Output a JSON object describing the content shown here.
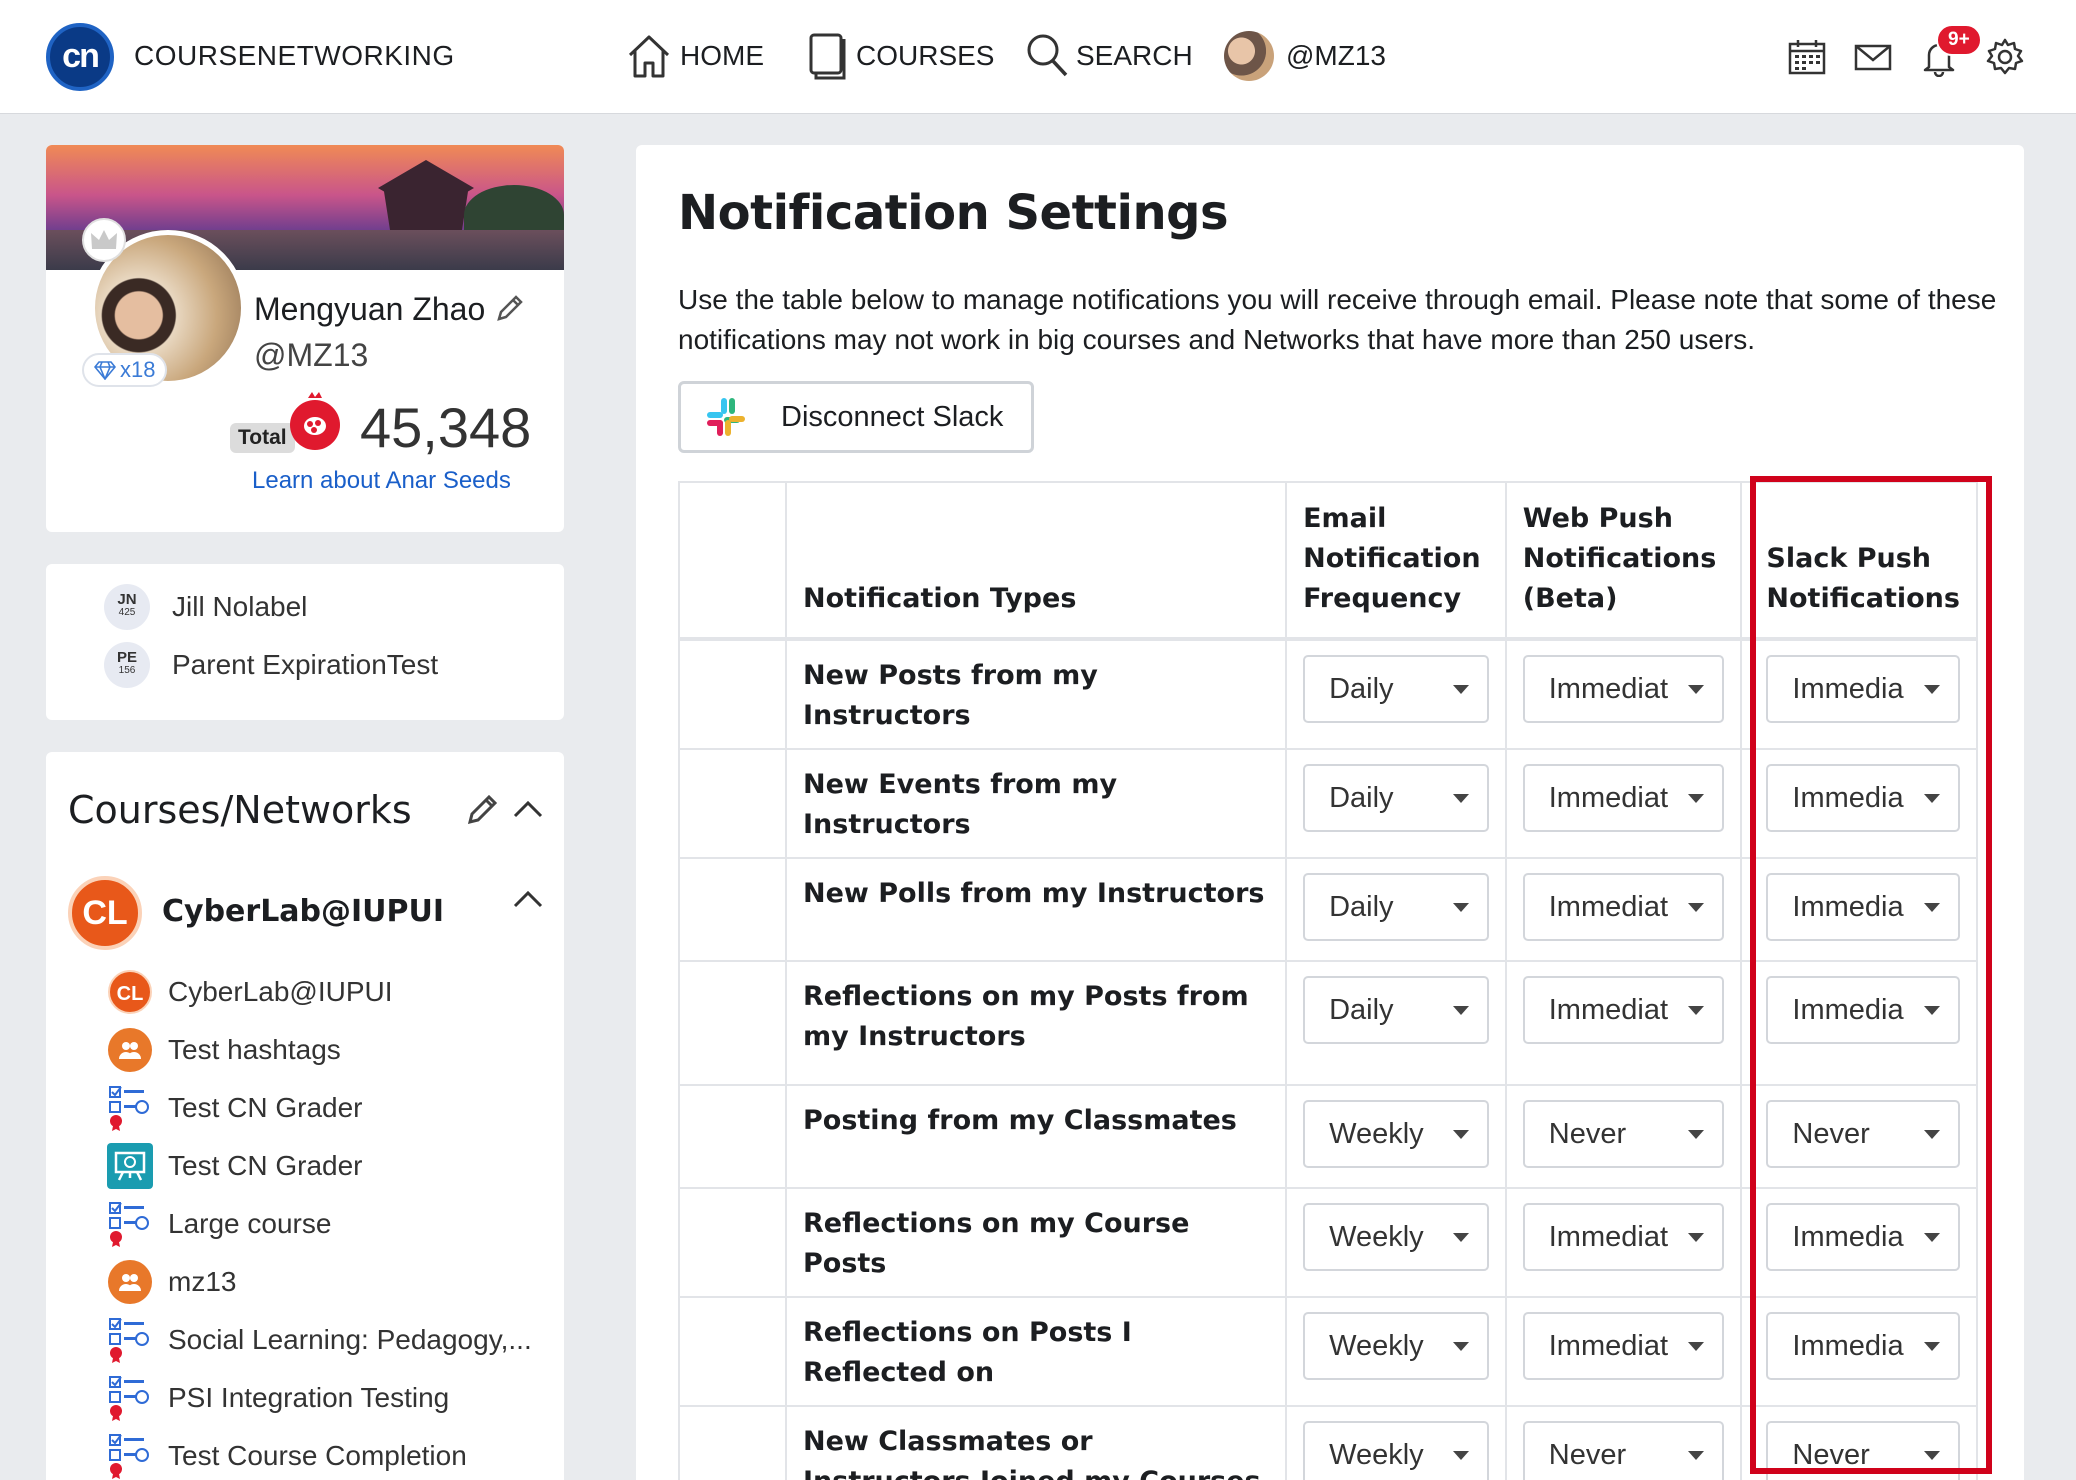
{
  "topbar": {
    "logo_text": "cn",
    "brand": "COURSENETWORKING",
    "nav": [
      {
        "label": "HOME",
        "icon": "home-icon"
      },
      {
        "label": "COURSES",
        "icon": "book-icon"
      },
      {
        "label": "SEARCH",
        "icon": "search-icon"
      }
    ],
    "user_handle": "@MZ13",
    "notification_badge": "9+",
    "right_icons": [
      "calendar-icon",
      "mail-icon",
      "bell-icon",
      "gear-icon"
    ]
  },
  "profile": {
    "name": "Mengyuan Zhao",
    "handle": "@MZ13",
    "diamonds": "x18",
    "total_label": "Total",
    "score": "45,348",
    "learn_link": "Learn about Anar Seeds"
  },
  "people": [
    {
      "initials": "JN",
      "number": "425",
      "name": "Jill Nolabel"
    },
    {
      "initials": "PE",
      "number": "156",
      "name": "Parent ExpirationTest"
    }
  ],
  "courses": {
    "title": "Courses/Networks",
    "group_logo": "CL",
    "group_name": "CyberLab@IUPUI",
    "items": [
      {
        "name": "CyberLab@IUPUI",
        "icon": "cyberlab-icon"
      },
      {
        "name": "Test hashtags",
        "icon": "group-icon"
      },
      {
        "name": "Test CN Grader",
        "icon": "course-checklist-icon"
      },
      {
        "name": "Test CN Grader",
        "icon": "course-board-icon"
      },
      {
        "name": "Large course",
        "icon": "course-checklist-icon"
      },
      {
        "name": "mz13",
        "icon": "group-icon"
      },
      {
        "name": "Social Learning: Pedagogy,...",
        "icon": "course-checklist-icon"
      },
      {
        "name": "PSI Integration Testing",
        "icon": "course-checklist-icon"
      },
      {
        "name": "Test Course Completion",
        "icon": "course-checklist-icon"
      }
    ]
  },
  "main": {
    "title": "Notification Settings",
    "description": "Use the table below to manage notifications you will receive through email. Please note that some of these notifications may not work in big courses and Networks that have more than 250 users.",
    "slack_button": "Disconnect Slack",
    "columns": {
      "type": "Notification Types",
      "email": "Email Notification Frequency",
      "web": "Web Push Notifications (Beta)",
      "slack": "Slack Push Notifications"
    },
    "rows": [
      {
        "type": "New Posts from my Instructors",
        "email": "Daily",
        "web": "Immediat",
        "slack": "Immedia"
      },
      {
        "type": "New Events from my Instructors",
        "email": "Daily",
        "web": "Immediat",
        "slack": "Immedia"
      },
      {
        "type": "New Polls from my Instructors",
        "email": "Daily",
        "web": "Immediat",
        "slack": "Immedia"
      },
      {
        "type": "Reflections on my Posts from my Instructors",
        "email": "Daily",
        "web": "Immediat",
        "slack": "Immedia"
      },
      {
        "type": "Posting from my Classmates",
        "email": "Weekly",
        "web": "Never",
        "slack": "Never"
      },
      {
        "type": "Reflections on my Course Posts",
        "email": "Weekly",
        "web": "Immediat",
        "slack": "Immedia"
      },
      {
        "type": "Reflections on Posts I Reflected on",
        "email": "Weekly",
        "web": "Immediat",
        "slack": "Immedia"
      },
      {
        "type": "New Classmates or Instructors Joined my Courses",
        "email": "Weekly",
        "web": "Never",
        "slack": "Never"
      }
    ]
  },
  "colors": {
    "highlight": "#d0021b",
    "link": "#1a5fc9",
    "brand": "#0a3a86",
    "badge": "#e0192e"
  }
}
